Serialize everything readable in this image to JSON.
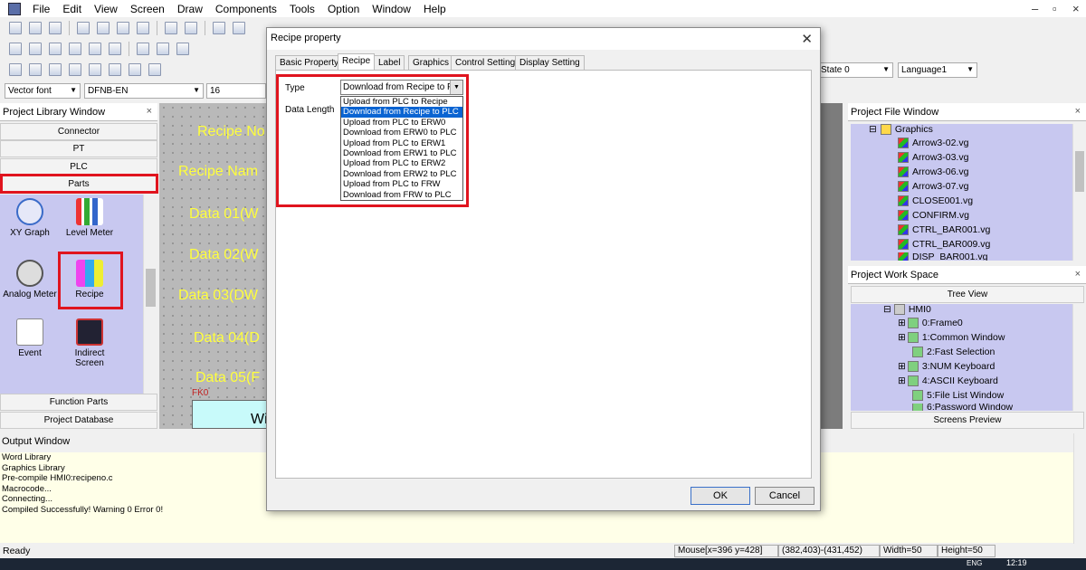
{
  "menu": [
    "File",
    "Edit",
    "View",
    "Screen",
    "Draw",
    "Components",
    "Tools",
    "Option",
    "Window",
    "Help"
  ],
  "toolbar": {
    "font": "Vector font",
    "font_name": "DFNB-EN",
    "font_size": "16",
    "state": "State 0",
    "language": "Language1"
  },
  "library": {
    "title": "Project Library Window",
    "categories": [
      "Connector",
      "PT",
      "PLC",
      "Parts"
    ],
    "parts": [
      "XY Graph",
      "Level Meter",
      "Analog Meter",
      "Recipe",
      "Event",
      "Indirect Screen"
    ],
    "bottom_categories": [
      "Function Parts",
      "Project Database"
    ]
  },
  "canvas": {
    "labels": [
      "Recipe No",
      "Recipe Nam",
      "Data 01(W",
      "Data 02(W",
      "Data 03(DW",
      "Data 04(D",
      "Data 05(F"
    ],
    "fk_label": "FK0",
    "box_text": "Wi"
  },
  "project_file": {
    "title": "Project File Window",
    "folder": "Graphics",
    "files": [
      "Arrow3-02.vg",
      "Arrow3-03.vg",
      "Arrow3-06.vg",
      "Arrow3-07.vg",
      "CLOSE001.vg",
      "CONFIRM.vg",
      "CTRL_BAR001.vg",
      "CTRL_BAR009.vg",
      "DISP_BAR001.vg"
    ]
  },
  "workspace": {
    "title": "Project Work Space",
    "view": "Tree View",
    "root": "HMI0",
    "items": [
      "0:Frame0",
      "1:Common Window",
      "2:Fast Selection",
      "3:NUM Keyboard",
      "4:ASCII Keyboard",
      "5:File List Window",
      "6:Password Window"
    ],
    "preview": "Screens Preview"
  },
  "output": {
    "title": "Output Window",
    "lines": [
      "Word Library",
      "Graphics Library",
      "Pre-compile HMI0:recipeno.c",
      "Macrocode...",
      "Connecting...",
      "Compiled Successfully! Warning 0 Error 0!"
    ]
  },
  "status": {
    "ready": "Ready",
    "mouse": "Mouse[x=396  y=428]",
    "range": "(382,403)-(431,452)",
    "width": "Width=50",
    "height": "Height=50"
  },
  "taskbar": {
    "lang": "ENG",
    "time": "12:19"
  },
  "dialog": {
    "title": "Recipe property",
    "tabs": [
      "Basic Property",
      "Recipe",
      "Label",
      "Graphics",
      "Control Setting",
      "Display Setting"
    ],
    "active_tab": "Recipe",
    "type_label": "Type",
    "data_length_label": "Data Length",
    "type_value": "Download from Recipe to P",
    "options": [
      "Upload from PLC to Recipe",
      "Download from Recipe to PLC",
      "Upload from PLC to ERW0",
      "Download from ERW0 to PLC",
      "Upload from PLC to ERW1",
      "Download from ERW1 to PLC",
      "Upload from PLC to ERW2",
      "Download from ERW2 to PLC",
      "Upload from PLC to FRW",
      "Download from FRW to PLC"
    ],
    "selected_option_index": 1,
    "ok": "OK",
    "cancel": "Cancel"
  },
  "colors": {
    "highlight": "#e0141e",
    "selection": "#0a64d2",
    "canvas_text": "#ffff3c"
  }
}
